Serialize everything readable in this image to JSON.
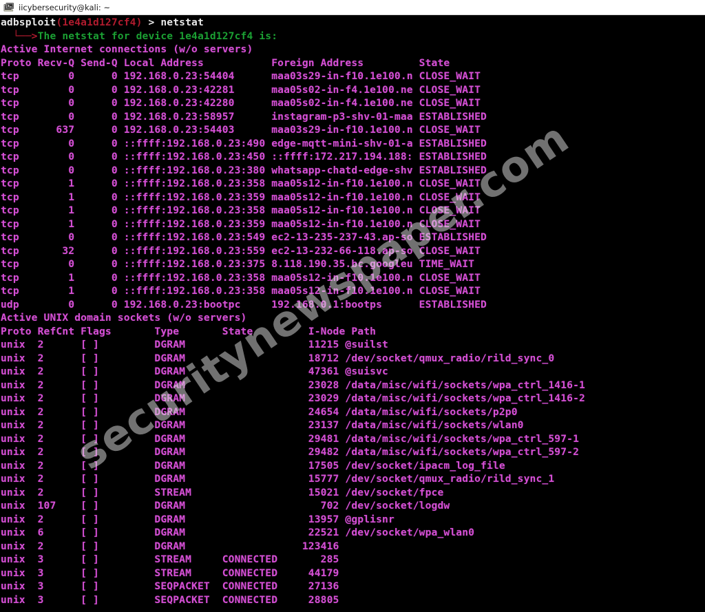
{
  "window": {
    "title": "iicybersecurity@kali: ~",
    "icon": "terminal-icon"
  },
  "watermark": {
    "text": "securitynewspaper.com"
  },
  "colors": {
    "background": "#000000",
    "magenta": "#d44fd4",
    "white": "#e8e8e8",
    "red": "#b01b2e",
    "green": "#1ba033",
    "titlebar_bg": "#ffffff"
  },
  "terminal": {
    "prompt": {
      "app": "adbsploit",
      "device": "(1e4a1d127cf4)",
      "separator": "> ",
      "command": "netstat"
    },
    "status_line": {
      "arrow": "  └──>",
      "text": "The netstat for device 1e4a1d127cf4 is:"
    },
    "internet_section": {
      "heading": "Active Internet connections (w/o servers)",
      "header": "Proto Recv-Q Send-Q Local Address           Foreign Address         State      ",
      "rows": [
        "tcp        0      0 192.168.0.23:54404      maa03s29-in-f10.1e100.n CLOSE_WAIT ",
        "tcp        0      0 192.168.0.23:42281      maa05s02-in-f4.1e100.ne CLOSE_WAIT ",
        "tcp        0      0 192.168.0.23:42280      maa05s02-in-f4.1e100.ne CLOSE_WAIT ",
        "tcp        0      0 192.168.0.23:58957      instagram-p3-shv-01-maa ESTABLISHED",
        "tcp      637      0 192.168.0.23:54403      maa03s29-in-f10.1e100.n CLOSE_WAIT ",
        "tcp        0      0 ::ffff:192.168.0.23:490 edge-mqtt-mini-shv-01-a ESTABLISHED",
        "tcp        0      0 ::ffff:192.168.0.23:450 ::ffff:172.217.194.188: ESTABLISHED",
        "tcp        0      0 ::ffff:192.168.0.23:380 whatsapp-chatd-edge-shv ESTABLISHED",
        "tcp        1      0 ::ffff:192.168.0.23:358 maa05s12-in-f10.1e100.n CLOSE_WAIT ",
        "tcp        1      0 ::ffff:192.168.0.23:359 maa05s12-in-f10.1e100.n CLOSE_WAIT ",
        "tcp        1      0 ::ffff:192.168.0.23:358 maa05s12-in-f10.1e100.n CLOSE_WAIT ",
        "tcp        1      0 ::ffff:192.168.0.23:359 maa05s12-in-f10.1e100.n CLOSE_WAIT ",
        "tcp        0      0 ::ffff:192.168.0.23:549 ec2-13-235-237-43.ap-so ESTABLISHED",
        "tcp       32      0 ::ffff:192.168.0.23:559 ec2-13-232-66-118.ap-so CLOSE_WAIT ",
        "tcp        0      0 ::ffff:192.168.0.23:375 8.118.190.35.bc.googleu TIME_WAIT  ",
        "tcp        1      0 ::ffff:192.168.0.23:358 maa05s12-in-f10.1e100.n CLOSE_WAIT ",
        "tcp        1      0 ::ffff:192.168.0.23:358 maa05s12-in-f10.1e100.n CLOSE_WAIT ",
        "udp        0      0 192.168.0.23:bootpc     192.168.0.1:bootps      ESTABLISHED"
      ]
    },
    "unix_section": {
      "heading": "Active UNIX domain sockets (w/o servers)",
      "header": "Proto RefCnt Flags       Type       State         I-Node Path",
      "rows": [
        "unix  2      [ ]         DGRAM                    11215 @suilst",
        "unix  2      [ ]         DGRAM                    18712 /dev/socket/qmux_radio/rild_sync_0",
        "unix  2      [ ]         DGRAM                    47361 @suisvc",
        "unix  2      [ ]         DGRAM                    23028 /data/misc/wifi/sockets/wpa_ctrl_1416-1",
        "unix  2      [ ]         DGRAM                    23029 /data/misc/wifi/sockets/wpa_ctrl_1416-2",
        "unix  2      [ ]         DGRAM                    24654 /data/misc/wifi/sockets/p2p0",
        "unix  2      [ ]         DGRAM                    23137 /data/misc/wifi/sockets/wlan0",
        "unix  2      [ ]         DGRAM                    29481 /data/misc/wifi/sockets/wpa_ctrl_597-1",
        "unix  2      [ ]         DGRAM                    29482 /data/misc/wifi/sockets/wpa_ctrl_597-2",
        "unix  2      [ ]         DGRAM                    17505 /dev/socket/ipacm_log_file",
        "unix  2      [ ]         DGRAM                    15777 /dev/socket/qmux_radio/rild_sync_1",
        "unix  2      [ ]         STREAM                   15021 /dev/socket/fpce",
        "unix  107    [ ]         DGRAM                      702 /dev/socket/logdw",
        "unix  2      [ ]         DGRAM                    13957 @gplisnr",
        "unix  6      [ ]         DGRAM                    22521 /dev/socket/wpa_wlan0",
        "unix  2      [ ]         DGRAM                   123416 ",
        "unix  3      [ ]         STREAM     CONNECTED       285 ",
        "unix  3      [ ]         STREAM     CONNECTED     44179 ",
        "unix  3      [ ]         SEQPACKET  CONNECTED     27136 ",
        "unix  3      [ ]         SEQPACKET  CONNECTED     28805 "
      ]
    }
  }
}
